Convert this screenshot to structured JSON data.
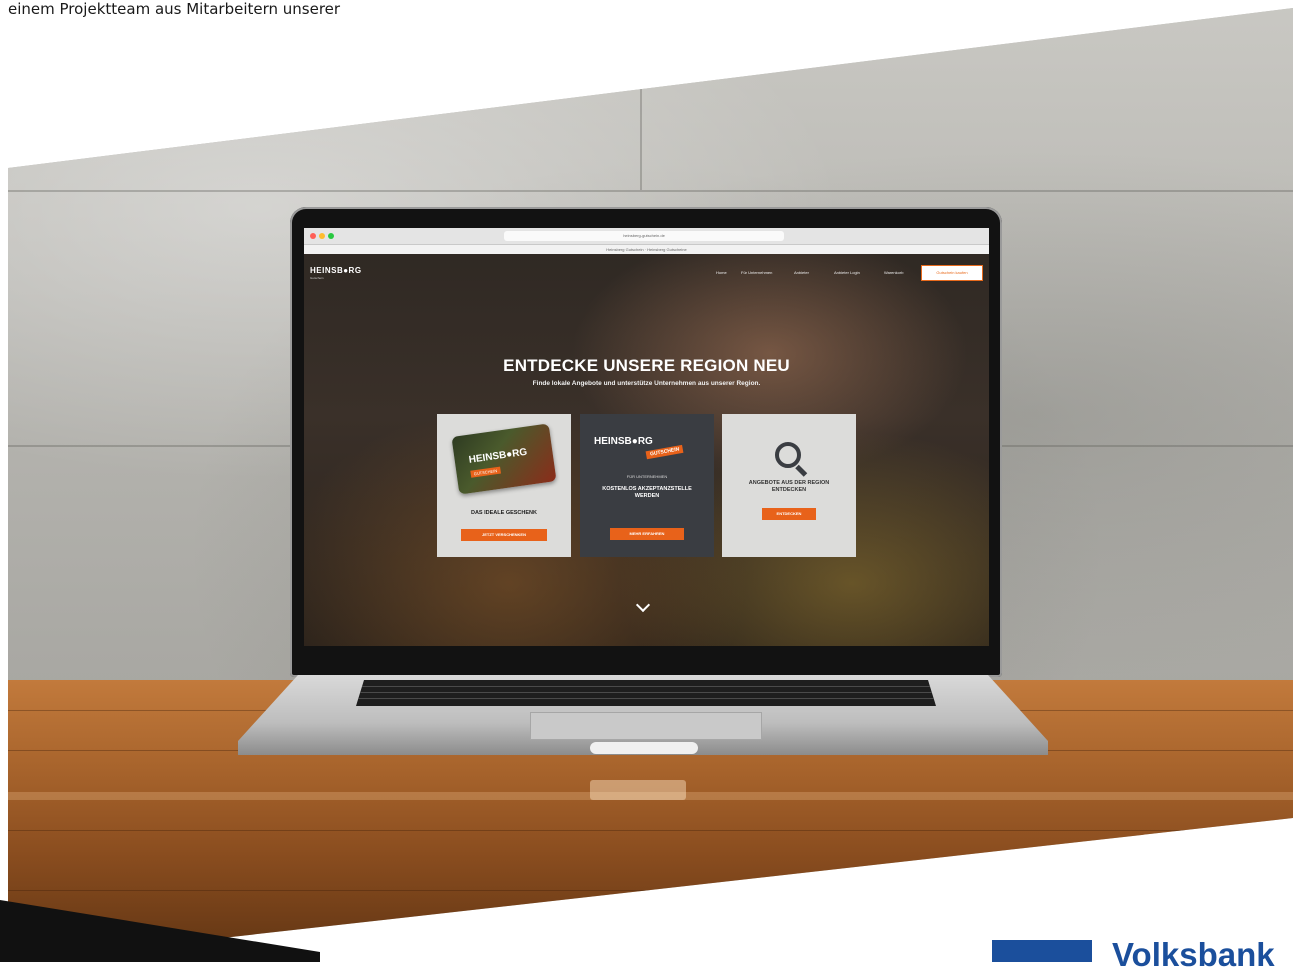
{
  "intro_text": "einem Projektteam aus Mitarbeitern unserer",
  "browser": {
    "url": "heinsberg-gutschein.de",
    "bookmarks": "Heinsberg Gutschein · Heinsberg Gutscheine"
  },
  "site": {
    "logo": "HEINSB●RG",
    "logo_sub": "Gutschein",
    "nav": [
      "Home",
      "Für Unternehmen",
      "Anbieter",
      "Anbieter Login",
      "Warenkorb"
    ],
    "nav_cta": "Gutschein kaufen",
    "hero_title": "ENTDECKE UNSERE REGION NEU",
    "hero_subtitle": "Finde lokale Angebote und unterstütze Unternehmen aus unserer Region.",
    "cards": [
      {
        "giftcard_logo": "HEINSB●RG",
        "giftcard_badge": "GUTSCHEIN",
        "title": "DAS IDEALE GESCHENK",
        "button": "JETZT VERSCHENKEN"
      },
      {
        "logo": "HEINSB●RG",
        "ribbon": "GUTSCHEIN",
        "small": "FÜR UNTERNEHMEN",
        "title": "KOSTENLOS AKZEPTANZSTELLE WERDEN",
        "button": "MEHR ERFAHREN"
      },
      {
        "icon": "search-icon",
        "title": "ANGEBOTE AUS DER REGION ENTDECKEN",
        "button": "ENTDECKEN"
      }
    ]
  },
  "brand": {
    "name": "Volksbank",
    "color": "#1b4f9c"
  },
  "accent": "#e8621a"
}
